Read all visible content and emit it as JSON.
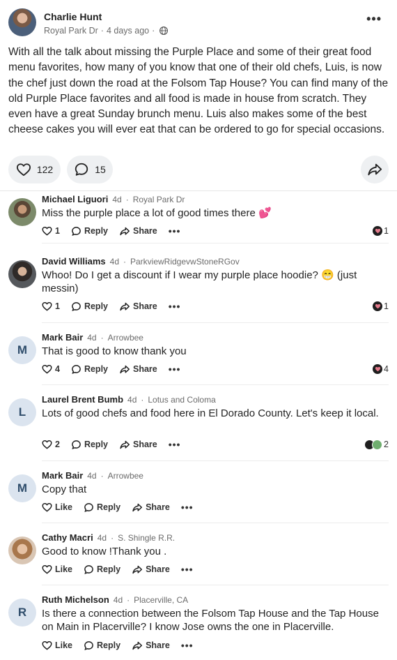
{
  "post": {
    "author": "Charlie Hunt",
    "neighborhood": "Royal Park Dr",
    "time": "4 days ago",
    "body": "With all the talk about missing the Purple Place and some of their great food menu favorites, how many of you know that one of their old chefs, Luis, is now the chef just down the road at the Folsom Tap House? You can find many of the old Purple Place favorites and all food is made in house from scratch. They even have a great Sunday brunch menu. Luis also makes some of the best cheese cakes you will ever eat that can be ordered to go for special occasions.",
    "like_count": "122",
    "comment_count": "15"
  },
  "comments": [
    {
      "name": "Michael Liguori",
      "age": "4d",
      "place": "Royal Park Dr",
      "text": "Miss the purple place a lot of good times there 💕",
      "likes": "1",
      "reply": "Reply",
      "share": "Share",
      "reactions": "1"
    },
    {
      "name": "David Williams",
      "age": "4d",
      "place": "ParkviewRidgevwStoneRGov",
      "text": "Whoo! Do I get a discount if I wear my purple place hoodie? 😁 (just messin)",
      "likes": "1",
      "reply": "Reply",
      "share": "Share",
      "reactions": "1"
    },
    {
      "name": "Mark Bair",
      "age": "4d",
      "place": "Arrowbee",
      "initial": "M",
      "text": "That is good to know thank you",
      "likes": "4",
      "reply": "Reply",
      "share": "Share",
      "reactions": "4"
    },
    {
      "name": "Laurel Brent Bumb",
      "age": "4d",
      "place": "Lotus and Coloma",
      "initial": "L",
      "text": "Lots of good chefs and food here in El Dorado County. Let's keep it local.",
      "likes": "2",
      "reply": "Reply",
      "share": "Share",
      "reactions": "2"
    },
    {
      "name": "Mark Bair",
      "age": "4d",
      "place": "Arrowbee",
      "initial": "M",
      "text": "Copy that",
      "likes": "Like",
      "reply": "Reply",
      "share": "Share"
    },
    {
      "name": "Cathy Macri",
      "age": "4d",
      "place": "S. Shingle R.R.",
      "text": "Good to know !Thank you .",
      "likes": "Like",
      "reply": "Reply",
      "share": "Share"
    },
    {
      "name": "Ruth Michelson",
      "age": "4d",
      "place": "Placerville, CA",
      "initial": "R",
      "text": "Is there a connection between the Folsom Tap House and the Tap House on Main in Placerville? I know Jose owns the one in Placerville.",
      "likes": "Like",
      "reply": "Reply",
      "share": "Share"
    }
  ],
  "icons": {
    "more": "more-horizontal-icon",
    "globe": "globe-icon",
    "like": "heart-icon",
    "comment": "speech-bubble-icon",
    "share": "share-arrow-icon"
  },
  "colors": {
    "pill_bg": "#eef0f2",
    "reaction_heart": "#e27a8b"
  }
}
